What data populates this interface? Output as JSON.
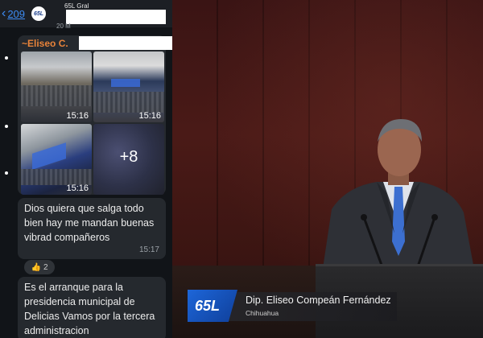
{
  "chat": {
    "header": {
      "back_count": "209",
      "group_avatar_text": "65L",
      "group_title": "65L Gral",
      "date_peek": "20 M"
    },
    "message_card": {
      "sender": "~Eliseo C.",
      "photos": [
        {
          "time": "15:16"
        },
        {
          "time": "15:16"
        },
        {
          "time": "15:16"
        },
        {
          "more_label": "+8"
        }
      ]
    },
    "messages": [
      {
        "text": "Dios quiera que salga todo bien hay me mandan buenas vibrad compañeros",
        "time": "15:17"
      },
      {
        "text": "Es el arranque para la presidencia municipal de Delicias Vamos por la tercera administracion"
      }
    ],
    "reaction": {
      "emoji": "👍",
      "count": "2"
    }
  },
  "broadcast": {
    "logo_text": "65L",
    "speaker_name": "Dip. Eliseo Compeán Fernández",
    "speaker_state": "Chihuahua"
  },
  "colors": {
    "chat_bg": "#111418",
    "bubble_bg": "#25292e",
    "sender_orange": "#e8833a",
    "link_blue": "#3d8bf2",
    "chamber_red": "#4a1a17",
    "logo_blue": "#1d66d9"
  }
}
